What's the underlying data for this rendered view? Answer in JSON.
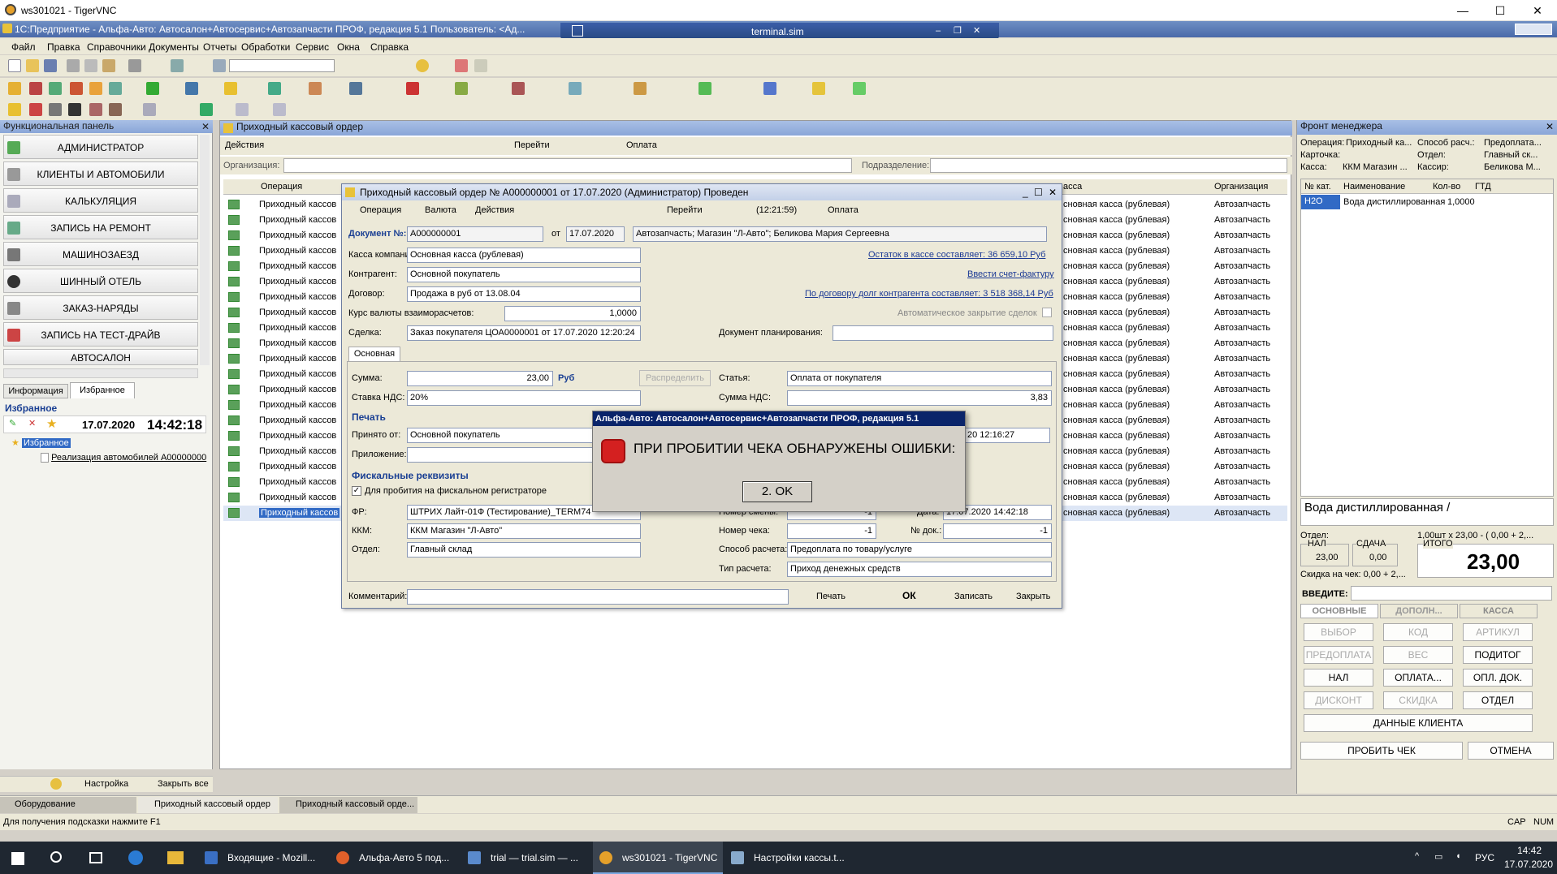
{
  "vnc": {
    "title": "ws301021 - TigerVNC",
    "min": "—",
    "max": "☐",
    "close": "✕"
  },
  "app": {
    "title": "1С:Предприятие - Альфа-Авто: Автосалон+Автосервис+Автозапчасти ПРОФ, редакция 5.1    Пользователь: <Ад...",
    "terminal": "terminal.sim"
  },
  "menu": [
    "Файл",
    "Правка",
    "Справочники",
    "Документы",
    "Отчеты",
    "Обработки",
    "Сервис",
    "Окна",
    "Справка"
  ],
  "left_panel": {
    "title": "Функциональная панель",
    "buttons": [
      "АДМИНИСТРАТОР",
      "КЛИЕНТЫ И АВТОМОБИЛИ",
      "КАЛЬКУЛЯЦИЯ",
      "ЗАПИСЬ НА РЕМОНТ",
      "МАШИНОЗАЕЗД",
      "ШИННЫЙ ОТЕЛЬ",
      "ЗАКАЗ-НАРЯДЫ",
      "ЗАПИСЬ НА ТЕСТ-ДРАЙВ",
      "АВТОСАЛОН"
    ],
    "tabs": [
      "Информация",
      "Избранное"
    ],
    "fav_header": "Избранное",
    "date": "17.07.2020",
    "time": "14:42:18",
    "tree_root": "Избранное",
    "tree_item": "Реализация автомобилей А00000000",
    "settings": "Настройка",
    "close_all": "Закрыть все"
  },
  "list_window": {
    "title": "Приходный кассовый ордер",
    "toolbar": [
      "Действия",
      "Перейти",
      "Оплата"
    ],
    "org_label": "Организация:",
    "dept_label": "Подразделение:",
    "col_operation": "Операция",
    "col_kassa": "асса",
    "col_org": "Организация",
    "row_operation": "Приходный кассов",
    "row_kassa": "сновная касса (рублевая)",
    "row_org": "Автозапчасть"
  },
  "doc": {
    "title": "Приходный кассовый ордер № А000000001 от 17.07.2020 (Администратор) Проведен",
    "toolbar": [
      "Операция",
      "Валюта",
      "Действия",
      "Перейти",
      "(12:21:59)",
      "Оплата"
    ],
    "doc_no_label": "Документ №:",
    "doc_no": "А000000001",
    "from_label": "от",
    "date": "17.07.2020",
    "org_info": "Автозапчасть; Магазин \"Л-Авто\"; Беликова Мария Сергеевна",
    "kassa_label": "Касса компании:",
    "kassa": "Основная касса (рублевая)",
    "kassa_link": "Остаток в кассе составляет: 36 659,10 Руб",
    "kontr_label": "Контрагент:",
    "kontr": "Основной покупатель",
    "invoice_link": "Ввести счет-фактуру",
    "dogovor_label": "Договор:",
    "dogovor": "Продажа в руб от 13.08.04",
    "dolg_link": "По договору долг контрагента составляет: 3 518 368,14 Руб",
    "kurs_label": "Курс валюты взаиморасчетов:",
    "kurs": "1,0000",
    "auto_close": "Автоматическое закрытие сделок",
    "sdelka_label": "Сделка:",
    "sdelka": "Заказ покупателя ЦОА0000001 от 17.07.2020 12:20:24",
    "plan_label": "Документ планирования:",
    "tab_main": "Основная",
    "summa_label": "Сумма:",
    "summa": "23,00",
    "currency": "Руб",
    "raspred": "Распределить",
    "statya_label": "Статья:",
    "statya": "Оплата от покупателя",
    "nds_label": "Ставка НДС:",
    "nds": "20%",
    "nds_sum_label": "Сумма НДС:",
    "nds_sum": "3,83",
    "print_header": "Печать",
    "prinyato_label": "Принято от:",
    "prinyato": "Основной покупатель",
    "date_time_partial": "20 12:16:27",
    "prilozh_label": "Приложение:",
    "fiscal_header": "Фискальные реквизиты",
    "fiscal_check": "Для пробития на фискальном регистраторе",
    "fr_label": "ФР:",
    "fr": "ШТРИХ Лайт-01Ф (Тестирование)_TERM74",
    "smena_label": "Номер смены:",
    "smena": "-1",
    "date_label": "Дата:",
    "date_val": "17.07.2020 14:42:18",
    "kkm_label": "ККМ:",
    "kkm": "ККМ Магазин \"Л-Авто\"",
    "check_label": "Номер чека:",
    "check": "-1",
    "ndok_label": "№ док.:",
    "ndok": "-1",
    "otdel_label": "Отдел:",
    "otdel": "Главный склад",
    "sposob_label": "Способ расчета:",
    "sposob": "Предоплата по товару/услуге",
    "tip_label": "Тип расчета:",
    "tip": "Приход денежных средств",
    "comment_label": "Комментарий:",
    "btn_print": "Печать",
    "btn_ok": "ОК",
    "btn_save": "Записать",
    "btn_close": "Закрыть"
  },
  "alert": {
    "title": "Альфа-Авто: Автосалон+Автосервис+Автозапчасти ПРОФ, редакция 5.1",
    "message": "ПРИ ПРОБИТИИ ЧЕКА ОБНАРУЖЕНЫ ОШИБКИ:",
    "button": "2. OK"
  },
  "front": {
    "title": "Фронт менеджера",
    "op_label": "Операция:",
    "op": "Приходный ка...",
    "sposob_label": "Способ расч.:",
    "sposob": "Предоплата...",
    "card_label": "Карточка:",
    "otdel_label": "Отдел:",
    "otdel": "Главный ск...",
    "kassa_label": "Касса:",
    "kassa": "ККМ Магазин ...",
    "kassir_label": "Кассир:",
    "kassir": "Беликова М...",
    "cols": [
      "№ кат.",
      "Наименование",
      "Кол-во",
      "ГТД"
    ],
    "row": [
      "Н2О",
      "Вода дистиллированная",
      "1,0000",
      ""
    ],
    "item_name": "Вода дистиллированная /",
    "otdel2_label": "Отдел:",
    "calc": "1,00шт x 23,00 - ( 0,00 + 2,...",
    "nal_label": "НАЛ",
    "nal": "23,00",
    "sdacha_label": "СДАЧА",
    "sdacha": "0,00",
    "itogo_label": "ИТОГО",
    "itogo": "23,00",
    "skidka": "Скидка на чек: 0,00 + 2,...",
    "vvedite": "ВВЕДИТЕ:",
    "tabs": [
      "ОСНОВНЫЕ",
      "ДОПОЛН...",
      "КАССА"
    ],
    "btns": [
      "ВЫБОР",
      "КОД",
      "АРТИКУЛ",
      "ПРЕДОПЛАТА",
      "ВЕС",
      "ПОДИТОГ",
      "НАЛ",
      "ОПЛАТА...",
      "ОПЛ. ДОК.",
      "ДИСКОНТ",
      "СКИДКА",
      "ОТДЕЛ"
    ],
    "client_btn": "ДАННЫЕ КЛИЕНТА",
    "probit": "ПРОБИТЬ ЧЕК",
    "otmena": "ОТМЕНА"
  },
  "bottom_tabs": [
    "Оборудование",
    "Приходный кассовый ордер",
    "Приходный кассовый орде..."
  ],
  "status": {
    "hint": "Для получения подсказки нажмите F1",
    "cap": "CAP",
    "num": "NUM"
  },
  "taskbar": {
    "items": [
      "Входящие - Mozill...",
      "Альфа-Авто 5 под...",
      "trial — trial.sim — ...",
      "ws301021 - TigerVNC",
      "Настройки кассы.t..."
    ],
    "lang": "РУС",
    "time": "14:42",
    "date": "17.07.2020"
  }
}
